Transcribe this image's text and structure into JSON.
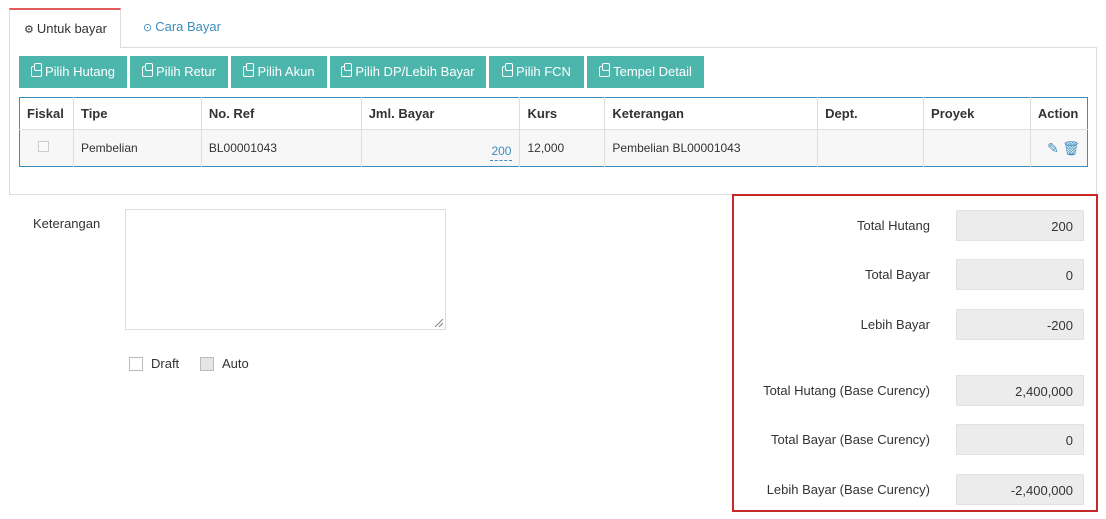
{
  "tabs": [
    {
      "label": "Untuk bayar",
      "icon": "gears-icon"
    },
    {
      "label": "Cara Bayar",
      "icon": "check-circle-icon"
    }
  ],
  "toolbar": [
    {
      "label": "Pilih Hutang",
      "icon": "copy-icon"
    },
    {
      "label": "Pilih Retur",
      "icon": "copy-icon"
    },
    {
      "label": "Pilih Akun",
      "icon": "copy-icon"
    },
    {
      "label": "Pilih DP/Lebih Bayar",
      "icon": "copy-icon"
    },
    {
      "label": "Pilih FCN",
      "icon": "copy-icon"
    },
    {
      "label": "Tempel Detail",
      "icon": "paste-icon"
    }
  ],
  "table": {
    "headers": [
      "Fiskal",
      "Tipe",
      "No. Ref",
      "Jml. Bayar",
      "Kurs",
      "Keterangan",
      "Dept.",
      "Proyek",
      "Action"
    ],
    "rows": [
      {
        "tipe": "Pembelian",
        "no_ref": "BL00001043",
        "jml_bayar": "200",
        "kurs": "12,000",
        "keterangan": "Pembelian BL00001043",
        "dept": "",
        "proyek": ""
      }
    ]
  },
  "form": {
    "keterangan_label": "Keterangan",
    "keterangan_value": "",
    "draft_label": "Draft",
    "auto_label": "Auto"
  },
  "summary": [
    {
      "label": "Total Hutang",
      "value": "200"
    },
    {
      "label": "Total Bayar",
      "value": "0"
    },
    {
      "label": "Lebih Bayar",
      "value": "-200"
    },
    {
      "label": "Total Hutang (Base Curency)",
      "value": "2,400,000"
    },
    {
      "label": "Total Bayar (Base Curency)",
      "value": "0"
    },
    {
      "label": "Lebih Bayar (Base Curency)",
      "value": "-2,400,000"
    }
  ],
  "colors": {
    "accent": "#4db6ac",
    "link": "#3c8dbc",
    "highlight_border": "#c62828",
    "active_tab": "#e25a5a"
  }
}
